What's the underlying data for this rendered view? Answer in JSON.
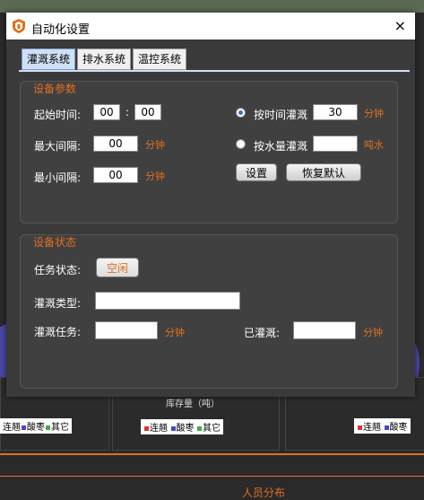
{
  "dialog": {
    "title": "自动化设置",
    "close_icon": "×"
  },
  "tabs": [
    {
      "label": "灌溉系统",
      "active": true
    },
    {
      "label": "排水系统",
      "active": false
    },
    {
      "label": "温控系统",
      "active": false
    }
  ],
  "params": {
    "group_title": "设备参数",
    "start_time_label": "起始时间:",
    "start_hour": "00",
    "time_sep": ":",
    "start_minute": "00",
    "max_interval_label": "最大间隔:",
    "max_interval_value": "00",
    "max_interval_unit": "分钟",
    "min_interval_label": "最小间隔:",
    "min_interval_value": "00",
    "min_interval_unit": "分钟",
    "by_time_label": "按时间灌溉",
    "by_time_value": "30",
    "by_time_unit": "分钟",
    "by_time_checked": true,
    "by_water_label": "按水量灌溉",
    "by_water_value": "",
    "by_water_unit": "吨水",
    "by_water_checked": false,
    "set_button": "设置",
    "reset_button": "恢复默认"
  },
  "status": {
    "group_title": "设备状态",
    "task_status_label": "任务状态:",
    "task_status_value": "空闲",
    "irrigation_type_label": "灌溉类型:",
    "irrigation_type_value": "",
    "irrigation_task_label": "灌溉任务:",
    "irrigation_task_value": "",
    "irrigation_task_unit": "分钟",
    "irrigated_label": "已灌溉:",
    "irrigated_value": "",
    "irrigated_unit": "分钟"
  },
  "background": {
    "legend_left": [
      "连翘",
      "酸枣",
      "其它"
    ],
    "legend_mid": [
      "连翘",
      "酸枣",
      "其它"
    ],
    "legend_right": [
      "连翘",
      "酸枣"
    ],
    "legend_colors": [
      "#e03030",
      "#4a46c8",
      "#3ab03a"
    ],
    "axis_label": "库存量（吨）",
    "bottom_title": "人员分布"
  },
  "colors": {
    "accent": "#e07020",
    "tab_active": "#cfe0f5",
    "dialog_bg": "#3a3a3a"
  }
}
